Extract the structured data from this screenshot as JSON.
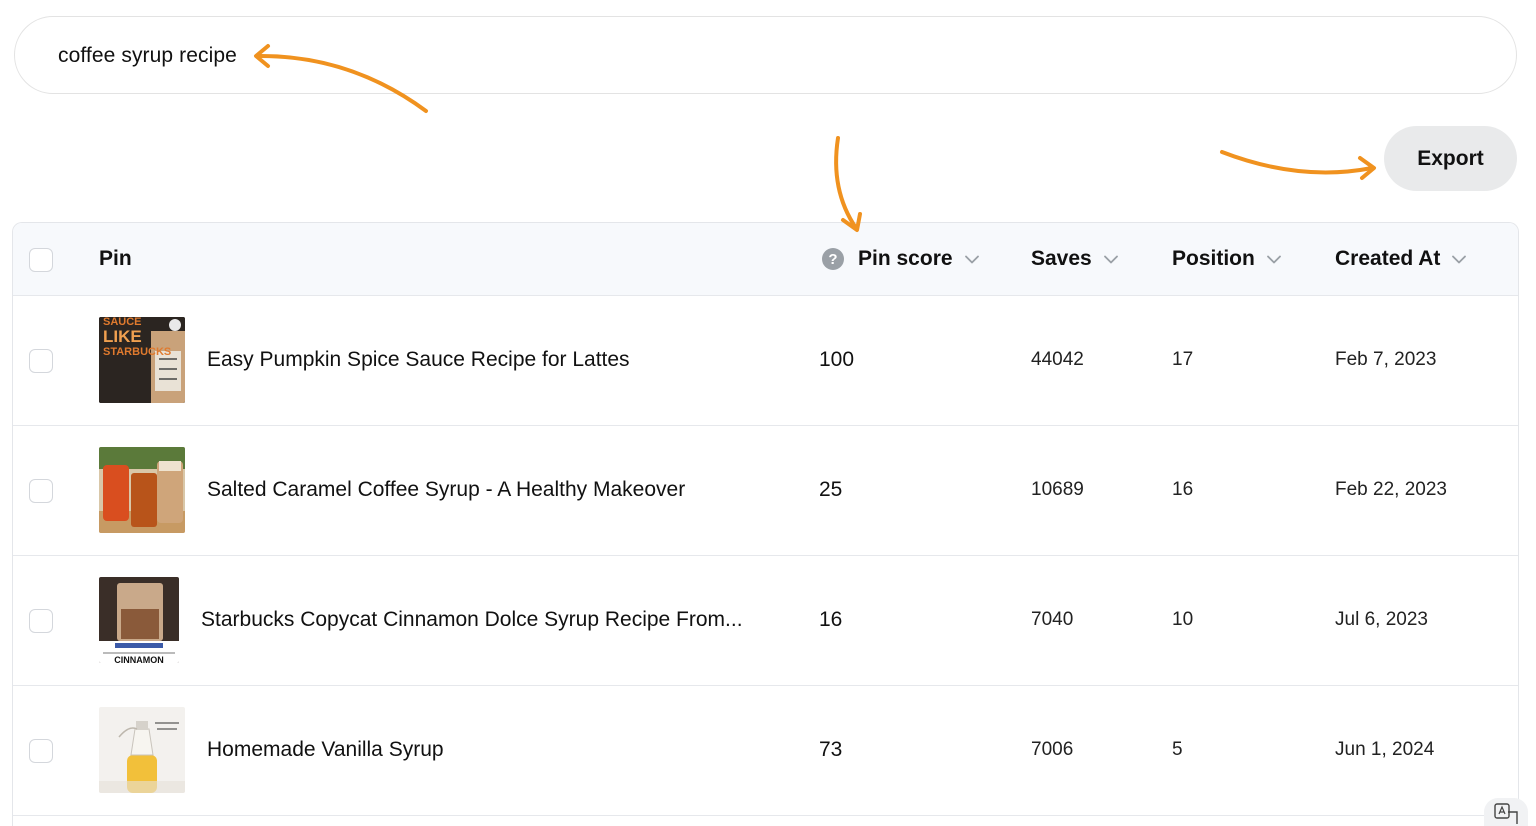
{
  "search": {
    "query": "coffee syrup recipe"
  },
  "toolbar": {
    "export_label": "Export"
  },
  "table": {
    "columns": {
      "pin": "Pin",
      "pin_score": "Pin score",
      "saves": "Saves",
      "position": "Position",
      "created_at": "Created At"
    },
    "help_glyph": "?",
    "rows": [
      {
        "title": "Easy Pumpkin Spice Sauce Recipe for Lattes",
        "pin_score": "100",
        "saves": "44042",
        "position": "17",
        "created_at": "Feb 7, 2023",
        "thumb_text": [
          "SAUCE",
          "LIKE",
          "STARBUCKS"
        ]
      },
      {
        "title": "Salted Caramel Coffee Syrup - A Healthy Makeover",
        "pin_score": "25",
        "saves": "10689",
        "position": "16",
        "created_at": "Feb 22, 2023"
      },
      {
        "title": "Starbucks Copycat Cinnamon Dolce Syrup Recipe From...",
        "pin_score": "16",
        "saves": "7040",
        "position": "10",
        "created_at": "Jul 6, 2023",
        "thumb_text": [
          "CINNAMON"
        ]
      },
      {
        "title": "Homemade Vanilla Syrup",
        "pin_score": "73",
        "saves": "7006",
        "position": "5",
        "created_at": "Jun 1, 2024"
      }
    ]
  },
  "colors": {
    "arrow": "#f0921f",
    "header_bg": "#f7f9fc",
    "button_bg": "#e9eaeb"
  },
  "icons": [
    "help-icon",
    "chevron-down-icon",
    "translate-icon",
    "arrow-annotation"
  ]
}
